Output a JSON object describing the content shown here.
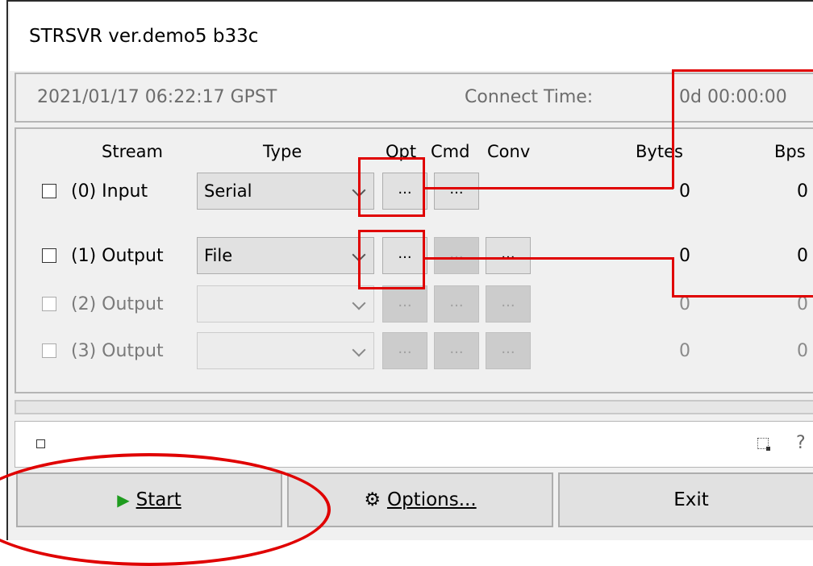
{
  "window": {
    "title": "STRSVR ver.demo5 b33c",
    "datetime": "2021/01/17 06:22:17 GPST",
    "connect_time_label": "Connect Time:",
    "connect_time_value": "0d 00:00:00"
  },
  "headers": {
    "stream": "Stream",
    "type": "Type",
    "opt": "Opt",
    "cmd": "Cmd",
    "conv": "Conv",
    "bytes": "Bytes",
    "bps": "Bps"
  },
  "rows": [
    {
      "stream": "(0) Input",
      "type": "Serial",
      "opt": "...",
      "cmd": "...",
      "bytes": "0",
      "bps": "0"
    },
    {
      "stream": "(1) Output",
      "type": "File",
      "opt": "...",
      "cmd": "...",
      "conv": "...",
      "bytes": "0",
      "bps": "0"
    },
    {
      "stream": "(2) Output",
      "type": "",
      "opt": "...",
      "cmd": "...",
      "conv": "...",
      "bytes": "0",
      "bps": "0"
    },
    {
      "stream": "(3) Output",
      "type": "",
      "opt": "...",
      "cmd": "...",
      "conv": "...",
      "bytes": "0",
      "bps": "0"
    }
  ],
  "statusbar": {
    "help": "?"
  },
  "buttons": {
    "start": "Start",
    "options": "Options...",
    "exit": "Exit"
  },
  "colors": {
    "annotation": "#e00000",
    "start_icon": "#1f9c1f"
  }
}
